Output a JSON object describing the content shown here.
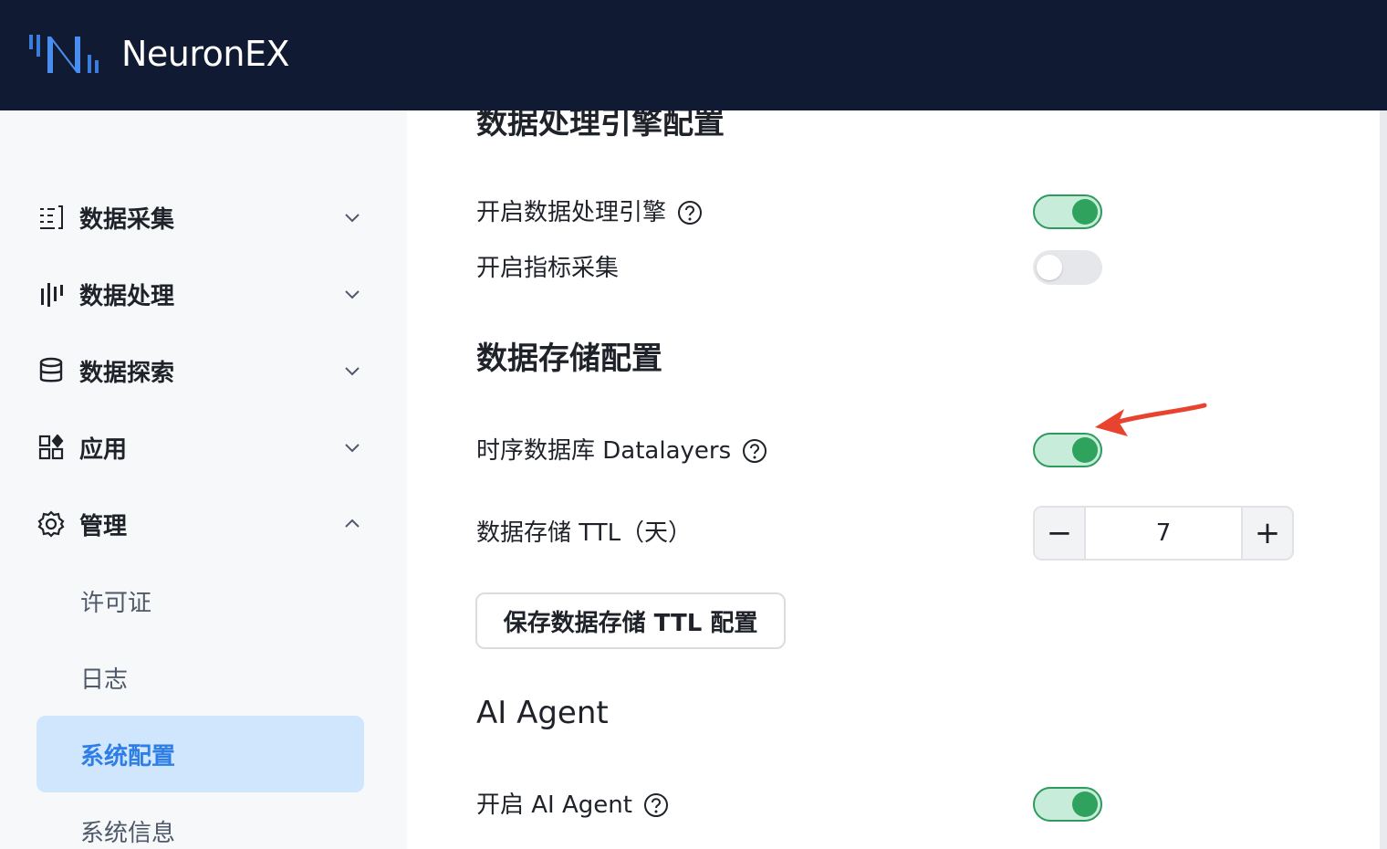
{
  "header": {
    "app_title": "NeuronEX"
  },
  "sidebar": {
    "items": [
      {
        "label": "数据采集",
        "icon": "data-collect-icon",
        "chevron": "down"
      },
      {
        "label": "数据处理",
        "icon": "data-process-icon",
        "chevron": "down"
      },
      {
        "label": "数据探索",
        "icon": "database-icon",
        "chevron": "down"
      },
      {
        "label": "应用",
        "icon": "apps-icon",
        "chevron": "down"
      },
      {
        "label": "管理",
        "icon": "gear-icon",
        "chevron": "up"
      }
    ],
    "sub_items": [
      {
        "label": "许可证",
        "active": false
      },
      {
        "label": "日志",
        "active": false
      },
      {
        "label": "系统配置",
        "active": true
      },
      {
        "label": "系统信息",
        "active": false
      }
    ]
  },
  "main": {
    "engine_section": {
      "title": "数据处理引擎配置",
      "enable_engine_label": "开启数据处理引擎",
      "enable_engine_on": true,
      "enable_metrics_label": "开启指标采集",
      "enable_metrics_on": false
    },
    "storage_section": {
      "title": "数据存储配置",
      "datalayers_label": "时序数据库 Datalayers",
      "datalayers_on": true,
      "ttl_label": "数据存储 TTL（天）",
      "ttl_value": "7",
      "decrement_symbol": "−",
      "increment_symbol": "+",
      "save_button_label": "保存数据存储 TTL 配置"
    },
    "ai_section": {
      "title": "AI Agent",
      "enable_ai_label": "开启 AI Agent",
      "enable_ai_on": true
    }
  },
  "colors": {
    "header_bg": "#101a33",
    "sidebar_bg": "#f7f8fa",
    "active_bg": "#cfe6fc",
    "active_text": "#2e7ee6",
    "switch_on": "#2fa25e",
    "switch_on_track": "#c7ecd9",
    "annotation_arrow": "#e8432e"
  }
}
